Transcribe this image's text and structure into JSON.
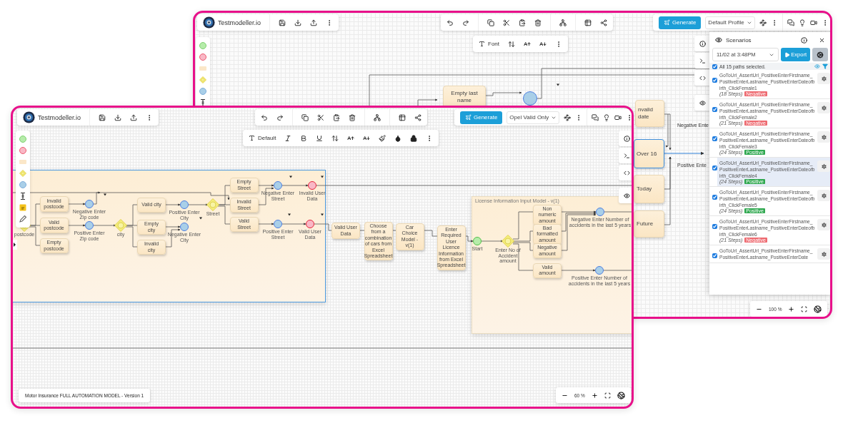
{
  "back_window": {
    "brand": "Testmodeller.io",
    "generate_button": "Generate",
    "profile_select": "Default Profile",
    "font_button": "Font",
    "nodes": [
      {
        "kind": "task",
        "label": "Empty last name",
        "selected": false
      },
      {
        "kind": "event",
        "selected": false
      },
      {
        "kind": "task",
        "label": "nvalid date",
        "selected": false
      },
      {
        "kind": "task",
        "label": "Over 16",
        "selected": true
      },
      {
        "kind": "task",
        "label": "Today",
        "selected": false
      },
      {
        "kind": "task",
        "label": "Future",
        "selected": false
      },
      {
        "kind": "text",
        "label": "Negative Ente",
        "selected": false
      },
      {
        "kind": "text",
        "label": "Positive Ente",
        "selected": false
      }
    ],
    "scenarios": {
      "title": "Scenarios",
      "run_select": "11/02 at 3:48PM",
      "export_button": "Export",
      "all_selected": true,
      "summary": "All 15 paths selected.",
      "items": [
        {
          "name": "GoToUrl_AssertUrl_PositiveEnterFirstname_PositiveEnterLastname_PositiveEnterDateofbirth_ClickFemale1",
          "steps": "(18 Steps)",
          "tag": {
            "label": "Negative",
            "color": "#ee6a70"
          },
          "checked": true,
          "selected": false
        },
        {
          "name": "GoToUrl_AssertUrl_PositiveEnterFirstname_PositiveEnterLastname_PositiveEnterDateofbirth_ClickFemale2",
          "steps": "(21 Steps)",
          "tag": {
            "label": "Negative",
            "color": "#ee6a70"
          },
          "checked": true,
          "selected": false
        },
        {
          "name": "GoToUrl_AssertUrl_PositiveEnterFirstname_PositiveEnterLastname_PositiveEnterDateofbirth_ClickFemale3",
          "steps": "(24 Steps)",
          "tag": {
            "label": "Positive",
            "color": "#2fa84f"
          },
          "checked": true,
          "selected": false
        },
        {
          "name": "GoToUrl_AssertUrl_PositiveEnterFirstname_PositiveEnterLastname_PositiveEnterDateofbirth_ClickFemale4",
          "steps": "(24 Steps)",
          "tag": {
            "label": "Positive",
            "color": "#2fa84f"
          },
          "checked": true,
          "selected": true
        },
        {
          "name": "GoToUrl_AssertUrl_PositiveEnterFirstname_PositiveEnterLastname_PositiveEnterDateofbirth_ClickFemale5",
          "steps": "(24 Steps)",
          "tag": {
            "label": "Positive",
            "color": "#2fa84f"
          },
          "checked": true,
          "selected": false
        },
        {
          "name": "GoToUrl_AssertUrl_PositiveEnterFirstname_PositiveEnterLastname_PositiveEnterDateofbirth_ClickFemale6",
          "steps": "(21 Steps)",
          "tag": {
            "label": "Negative",
            "color": "#ee6a70"
          },
          "checked": true,
          "selected": false
        },
        {
          "name": "GoToUrl_AssertUrl_PositiveEnterFirstname_PositiveEnterLastname_PositiveEnterDate",
          "checked": true,
          "selected": false
        }
      ]
    },
    "zoom": "100 %"
  },
  "front_window": {
    "brand": "Testmodeller.io",
    "generate_button": "Generate",
    "profile_select": "Opel Valid Only",
    "font_select": "Default",
    "groups": [
      {
        "selected": true
      },
      {
        "title": "License Information Input Model - v(1)",
        "selected": false
      }
    ],
    "nodes": [
      {
        "kind": "gateway",
        "label": "postcode"
      },
      {
        "kind": "task",
        "label": "Invalid postcode"
      },
      {
        "kind": "task",
        "label": "Valid postcode"
      },
      {
        "kind": "task",
        "label": "Empty postcode"
      },
      {
        "kind": "event",
        "label": "Negative Enter Zip code"
      },
      {
        "kind": "event",
        "label": "Positive Enter Zip code"
      },
      {
        "kind": "gateway",
        "label": "city"
      },
      {
        "kind": "task",
        "label": "Valid city"
      },
      {
        "kind": "task",
        "label": "Empty city"
      },
      {
        "kind": "task",
        "label": "Invalid city"
      },
      {
        "kind": "event",
        "label": "Positive Enter City"
      },
      {
        "kind": "event",
        "label": "Negative Enter City"
      },
      {
        "kind": "gateway",
        "label": "Street"
      },
      {
        "kind": "task",
        "label": "Empty Street"
      },
      {
        "kind": "task",
        "label": "Invalid Street"
      },
      {
        "kind": "task",
        "label": "Valid Street"
      },
      {
        "kind": "event",
        "label": "Negative Enter Street"
      },
      {
        "kind": "event",
        "label": "Positive Enter Street"
      },
      {
        "kind": "end",
        "label": "Invalid User Data"
      },
      {
        "kind": "end",
        "label": "Valid User Data"
      },
      {
        "kind": "task",
        "label": "Valid User Data"
      },
      {
        "kind": "task",
        "label": "Choose from a combination of cars from Excel Spreadsheet"
      },
      {
        "kind": "task",
        "label": "Car Choice Model - v(1)"
      },
      {
        "kind": "task",
        "label": "Enter Required User Licence Information from Excel Spreadsheet"
      },
      {
        "kind": "start",
        "label": "Start"
      },
      {
        "kind": "gateway",
        "label": "Enter No of Accident amount"
      },
      {
        "kind": "task",
        "label": "Non numeric amount"
      },
      {
        "kind": "task",
        "label": "Bad formatted amount"
      },
      {
        "kind": "task",
        "label": "Negative amount"
      },
      {
        "kind": "task",
        "label": "Valid amount"
      },
      {
        "kind": "event",
        "label": "Negative Enter Number of accidents in the last 5 years"
      },
      {
        "kind": "event",
        "label": "Positive Enter Number of accidents in the last 5 years"
      }
    ],
    "model_name": "Motor Insurance FULL AUTOMATION MODEL - Version 1",
    "zoom": "60 %"
  }
}
